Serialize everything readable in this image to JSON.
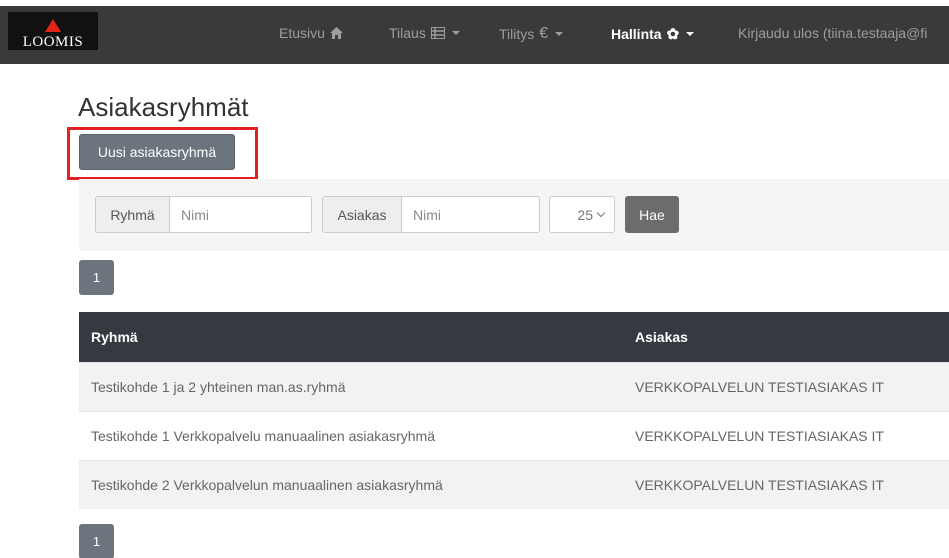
{
  "navbar": {
    "logo_text": "LOOMIS",
    "items": [
      {
        "label": "Etusivu",
        "icon": "home-icon"
      },
      {
        "label": "Tilaus",
        "icon": "list-icon"
      },
      {
        "label": "Tilitys",
        "icon": "euro-icon"
      },
      {
        "label": "Hallinta",
        "icon": "gear-icon"
      },
      {
        "label": "Kirjaudu ulos (tiina.testaaja@fi"
      }
    ],
    "active_item": "Hallinta"
  },
  "page": {
    "title": "Asiakasryhmät",
    "new_button_label": "Uusi asiakasryhmä"
  },
  "filters": {
    "group_label": "Ryhmä",
    "group_placeholder": "Nimi",
    "customer_label": "Asiakas",
    "customer_placeholder": "Nimi",
    "page_size": "25",
    "search_button_label": "Hae"
  },
  "pagination": {
    "current_page": "1"
  },
  "table": {
    "headers": [
      "Ryhmä",
      "Asiakas"
    ],
    "rows": [
      {
        "group": "Testikohde 1 ja 2 yhteinen man.as.ryhmä",
        "customer": "VERKKOPALVELUN TESTIASIAKAS IT"
      },
      {
        "group": "Testikohde 1 Verkkopalvelu manuaalinen asiakasryhmä",
        "customer": "VERKKOPALVELUN TESTIASIAKAS IT"
      },
      {
        "group": "Testikohde 2 Verkkopalvelun manuaalinen asiakasryhmä",
        "customer": "VERKKOPALVELUN TESTIASIAKAS IT"
      }
    ]
  },
  "colors": {
    "navbar_bg": "#3a3a3a",
    "button_gray": "#6c757d",
    "table_header_bg": "#343a40",
    "highlight_red": "#e31e24",
    "logo_accent": "#e2231a"
  }
}
